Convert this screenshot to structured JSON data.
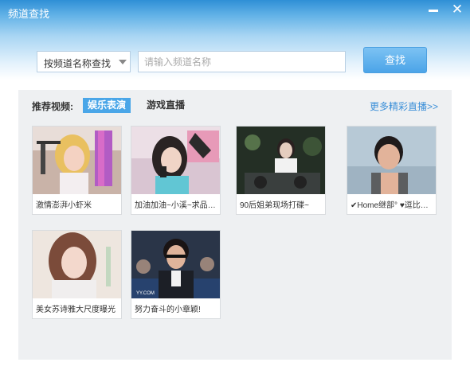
{
  "window": {
    "title": "频道查找",
    "minimize_label": "",
    "close_glyph": "✕"
  },
  "search": {
    "mode_label": "按频道名称查找",
    "placeholder": "请输入频道名称",
    "button_label": "查找"
  },
  "recommend": {
    "label": "推荐视频:",
    "tabs": [
      {
        "label": "娱乐表演",
        "active": true
      },
      {
        "label": "游戏直播",
        "active": false
      }
    ],
    "more_label": "更多精彩直播>>"
  },
  "videos": [
    {
      "caption": "激情澎湃小虾米"
    },
    {
      "caption": "加油加油~小溪~求品站…"
    },
    {
      "caption": "90后姐弟现场打碟~"
    },
    {
      "caption": "✔Home继部° ♥逗比链…"
    },
    {
      "caption": "美女苏诗雅大尺度曝光"
    },
    {
      "caption": "努力奋斗的小章颖!"
    }
  ],
  "colors": {
    "title_bar": "#2f8fd6",
    "accent": "#4aa6e8",
    "link": "#3b8fd8",
    "panel_bg": "#eef0f2"
  }
}
